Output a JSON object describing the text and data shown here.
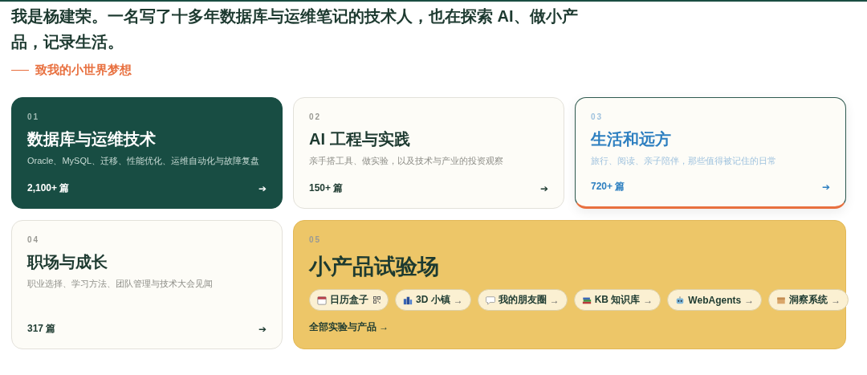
{
  "intro": "我是杨建荣。一名写了十多年数据库与运维笔记的技术人，也在探索 AI、做小产品，记录生活。",
  "tagline": "致我的小世界梦想",
  "cards": [
    {
      "kind": "dark",
      "selected": false,
      "number": "01",
      "title": "数据库与运维技术",
      "description": "Oracle、MySQL、迁移、性能优化、运维自动化与故障复盘",
      "count": "2,100+ 篇",
      "arrow": "➔"
    },
    {
      "kind": "light",
      "selected": false,
      "number": "02",
      "title": "AI 工程与实践",
      "description": "亲手搭工具、做实验，以及技术与产业的投资观察",
      "count": "150+ 篇",
      "arrow": "➔"
    },
    {
      "kind": "light",
      "selected": true,
      "number": "03",
      "title": "生活和远方",
      "description": "旅行、阅读、亲子陪伴，那些值得被记住的日常",
      "count": "720+ 篇",
      "arrow": "➔"
    },
    {
      "kind": "light",
      "selected": false,
      "number": "04",
      "title": "职场与成长",
      "description": "职业选择、学习方法、团队管理与技术大会见闻",
      "count": "317 篇",
      "arrow": "➔"
    },
    {
      "kind": "gold",
      "selected": false,
      "number": "05",
      "title": "小产品试验场",
      "chips": [
        {
          "label": "日历盒子",
          "kind": "qr"
        },
        {
          "label": "3D 小镇",
          "kind": "link",
          "arrow": "→"
        },
        {
          "label": "我的朋友圈",
          "kind": "link",
          "arrow": "→"
        },
        {
          "label": "KB 知识库",
          "kind": "link",
          "arrow": "→"
        },
        {
          "label": "WebAgents",
          "kind": "link",
          "arrow": "→"
        },
        {
          "label": "洞察系统",
          "kind": "link",
          "arrow": "→"
        }
      ],
      "link": "全部实验与产品 →"
    }
  ]
}
